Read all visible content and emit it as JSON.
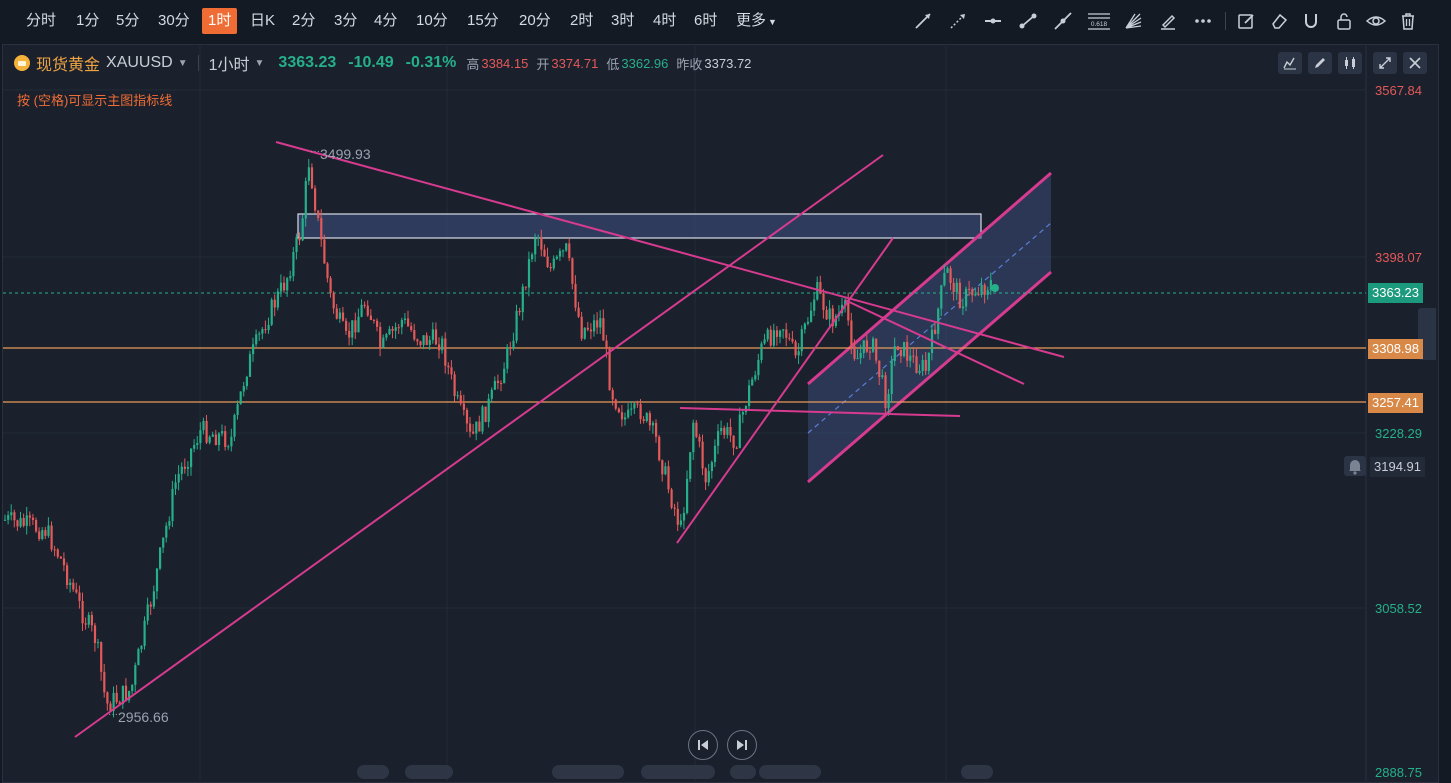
{
  "timeframes": [
    {
      "label": "分时",
      "active": false
    },
    {
      "label": "1分",
      "active": false
    },
    {
      "label": "5分",
      "active": false
    },
    {
      "label": "30分",
      "active": false
    },
    {
      "label": "1时",
      "active": true
    },
    {
      "label": "日K",
      "active": false
    },
    {
      "label": "2分",
      "active": false
    },
    {
      "label": "3分",
      "active": false
    },
    {
      "label": "4分",
      "active": false
    },
    {
      "label": "10分",
      "active": false
    },
    {
      "label": "15分",
      "active": false
    },
    {
      "label": "20分",
      "active": false
    },
    {
      "label": "2时",
      "active": false
    },
    {
      "label": "3时",
      "active": false
    },
    {
      "label": "4时",
      "active": false
    },
    {
      "label": "6时",
      "active": false
    },
    {
      "label": "更多",
      "active": false
    }
  ],
  "drawing_tools": [
    "trend-line-icon",
    "ray-line-icon",
    "horizontal-line-icon",
    "segment-icon",
    "extended-line-icon",
    "fibonacci-icon",
    "gann-fan-icon",
    "brush-icon",
    "more-tools-icon",
    "note-edit-icon",
    "eraser-icon",
    "magnet-icon",
    "lock-icon",
    "visibility-icon",
    "trash-icon"
  ],
  "fib_label": "0.618",
  "header": {
    "symbol_cn": "现货黄金",
    "symbol": "XAUUSD",
    "period": "1小时",
    "last": "3363.23",
    "change": "-10.49",
    "change_pct": "-0.31%",
    "high_label": "高",
    "high": "3384.15",
    "open_label": "开",
    "open": "3374.71",
    "low_label": "低",
    "low": "3362.96",
    "prev_label": "昨收",
    "prev_close": "3373.72"
  },
  "hint": "按 (空格)可显示主图指标线",
  "window_buttons": [
    "indicator-icon",
    "edit-icon",
    "candle-type-icon",
    "expand-icon",
    "close-icon"
  ],
  "annotations": {
    "max": "3499.93",
    "min": "2956.66"
  },
  "price_axis": {
    "labels": [
      "3567.84",
      "3398.07",
      "3228.29",
      "3058.52",
      "2888.75"
    ],
    "tags": {
      "current": "3363.23",
      "level1": "3308.98",
      "level2": "3257.41",
      "alert": "3194.91"
    }
  },
  "colors": {
    "up": "#26b08a",
    "down": "#e45959",
    "drawing": "#d63b8f",
    "level": "#e89a5a",
    "accent": "#ef6d35"
  }
}
